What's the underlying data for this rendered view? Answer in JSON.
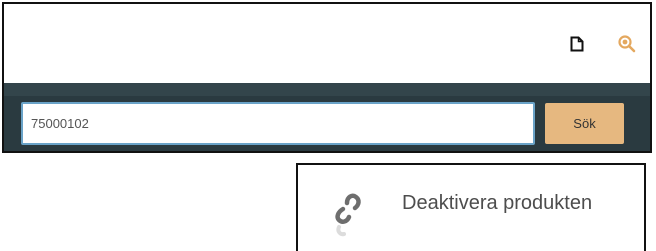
{
  "header": {
    "icons": {
      "document": "document-icon",
      "search": "search-icon"
    },
    "accent_color": "#e6b880"
  },
  "search": {
    "value": "75000102",
    "button_label": "Sök"
  },
  "actions": {
    "deactivate": {
      "label": "Deaktivera produkten",
      "icon": "unlink-icon"
    }
  }
}
